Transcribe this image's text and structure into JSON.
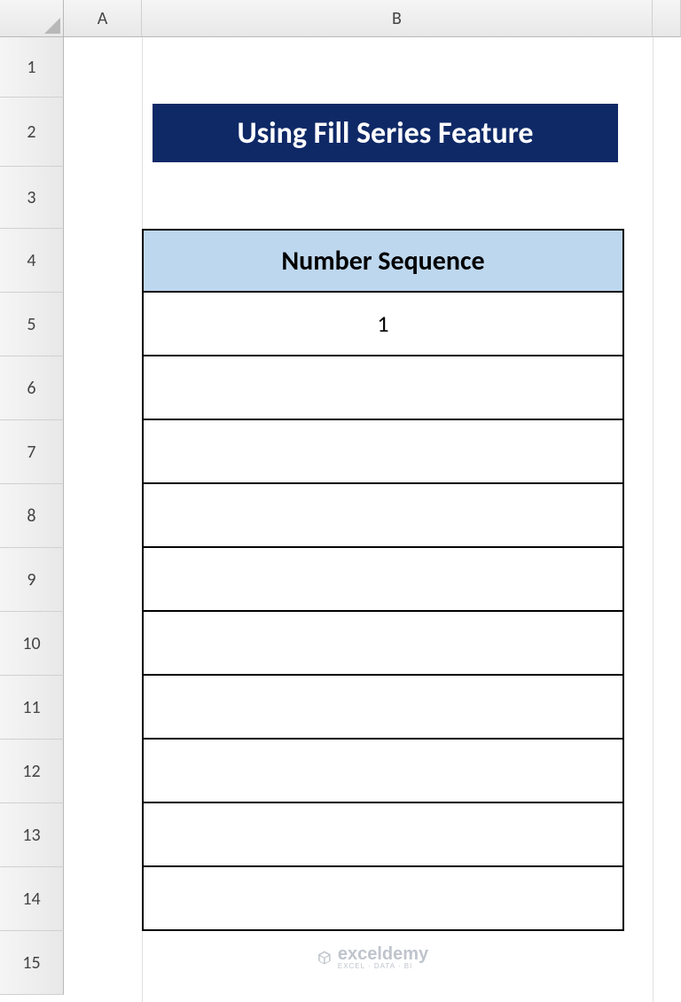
{
  "columns": [
    "A",
    "B"
  ],
  "rows": [
    "1",
    "2",
    "3",
    "4",
    "5",
    "6",
    "7",
    "8",
    "9",
    "10",
    "11",
    "12",
    "13",
    "14",
    "15"
  ],
  "title": "Using Fill Series Feature",
  "table": {
    "header": "Number Sequence",
    "values": [
      "1",
      "",
      "",
      "",
      "",
      "",
      "",
      "",
      "",
      ""
    ]
  },
  "watermark": {
    "brand": "exceldemy",
    "tagline": "EXCEL · DATA · BI"
  },
  "colors": {
    "title_bg": "#0f2967",
    "header_bg": "#bdd7ee"
  }
}
